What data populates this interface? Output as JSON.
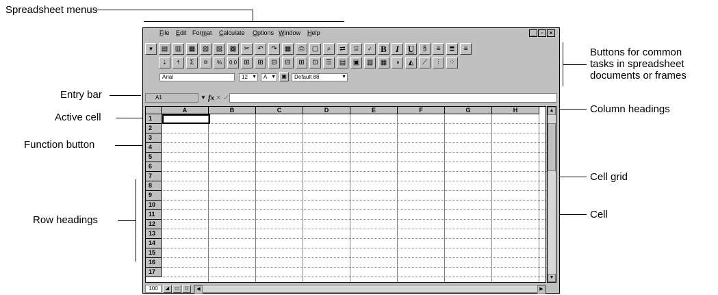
{
  "callouts": {
    "spreadsheet_menus": "Spreadsheet menus",
    "buttons_common": "Buttons for common",
    "tasks_in": "tasks in spreadsheet",
    "documents_or": "documents or frames",
    "entry_bar": "Entry bar",
    "active_cell": "Active cell",
    "function_button": "Function button",
    "row_headings": "Row headings",
    "column_headings": "Column headings",
    "cell_grid": "Cell grid",
    "cell": "Cell"
  },
  "menus": [
    "File",
    "Edit",
    "Format",
    "Calculate",
    "Options",
    "Window",
    "Help"
  ],
  "menu_underlines": [
    "F",
    "E",
    "m",
    "C",
    "O",
    "W",
    "H"
  ],
  "toolbar": {
    "font": "Arial",
    "size": "12",
    "style": "A",
    "format": "Default 88",
    "bold": "B",
    "italic": "I",
    "underline": "U",
    "sum": "Σ",
    "percent": "%",
    "decimal": "0.0"
  },
  "entry": {
    "cell_ref": "A1",
    "fx": "fx",
    "cancel": "×",
    "accept": "✓"
  },
  "columns": [
    "A",
    "B",
    "C",
    "D",
    "E",
    "F",
    "G",
    "H"
  ],
  "rows": [
    "1",
    "2",
    "3",
    "4",
    "5",
    "6",
    "7",
    "8",
    "9",
    "10",
    "11",
    "12",
    "13",
    "14",
    "15",
    "16",
    "17"
  ],
  "status": {
    "zoom": "100"
  },
  "window_controls": {
    "minimize": "_",
    "restore": "▫",
    "close": "×"
  }
}
